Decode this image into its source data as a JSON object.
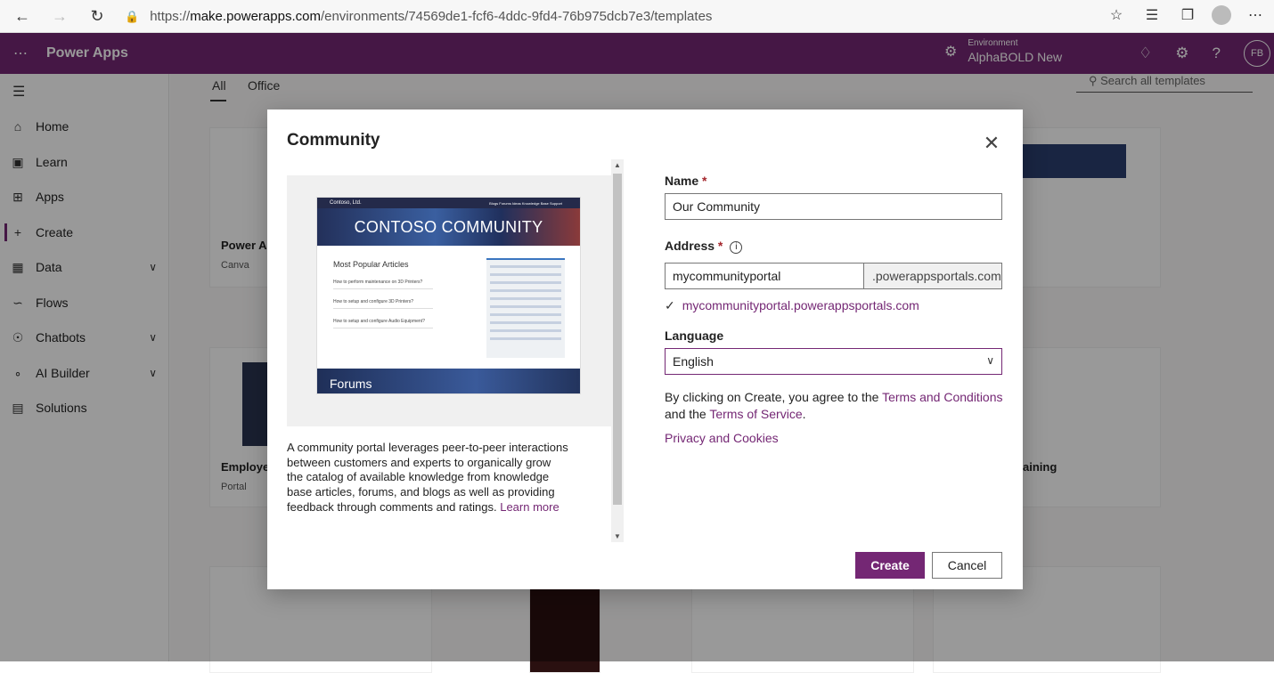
{
  "browser": {
    "url_prefix": "https://",
    "url_host": "make.powerapps.com",
    "url_path": "/environments/74569de1-fcf6-4ddc-9fd4-76b975dcb7e3/templates"
  },
  "header": {
    "app_title": "Power Apps",
    "env_label": "Environment",
    "env_name": "AlphaBOLD New",
    "avatar": "FB"
  },
  "nav": {
    "items": [
      {
        "label": "Home"
      },
      {
        "label": "Learn"
      },
      {
        "label": "Apps"
      },
      {
        "label": "Create"
      },
      {
        "label": "Data"
      },
      {
        "label": "Flows"
      },
      {
        "label": "Chatbots"
      },
      {
        "label": "AI Builder"
      },
      {
        "label": "Solutions"
      }
    ]
  },
  "main": {
    "tabs": [
      "All",
      "Office"
    ],
    "search_placeholder": "Search all templates",
    "cards": [
      {
        "title": "Power Ap",
        "sub": "Canva"
      },
      {
        "title": "Employe",
        "sub": "Portal"
      },
      {
        "title": "aining",
        "sub": ""
      }
    ]
  },
  "dialog": {
    "title": "Community",
    "preview": {
      "brand": "Contoso, Ltd.",
      "menu": "Blogs  Forums  Ideas  Knowledge Base  Support",
      "hero": "CONTOSO COMMUNITY",
      "heading": "Most Popular Articles",
      "articles": [
        "How to perform maintenance on 3D Printers?",
        "How to setup and configure 3D Printers?",
        "How to setup and configure Audio Equipment?"
      ],
      "footer": "Forums"
    },
    "description": "A community portal leverages peer-to-peer interactions between customers and experts to organically grow the catalog of available knowledge from knowledge base articles, forums, and blogs as well as providing feedback through comments and ratings.",
    "learn_more": "Learn more",
    "name_label": "Name",
    "name_value": "Our Community",
    "address_label": "Address",
    "address_value": "mycommunityportal",
    "address_suffix": ".powerappsportals.com",
    "address_valid": "mycommunityportal.powerappsportals.com",
    "language_label": "Language",
    "language_value": "English",
    "terms_prefix": "By clicking on Create, you agree to the ",
    "terms_link": "Terms and Conditions",
    "terms_middle": "and the ",
    "tos_link": "Terms of Service",
    "terms_end": ".",
    "privacy_link": "Privacy and Cookies",
    "create_label": "Create",
    "cancel_label": "Cancel"
  }
}
